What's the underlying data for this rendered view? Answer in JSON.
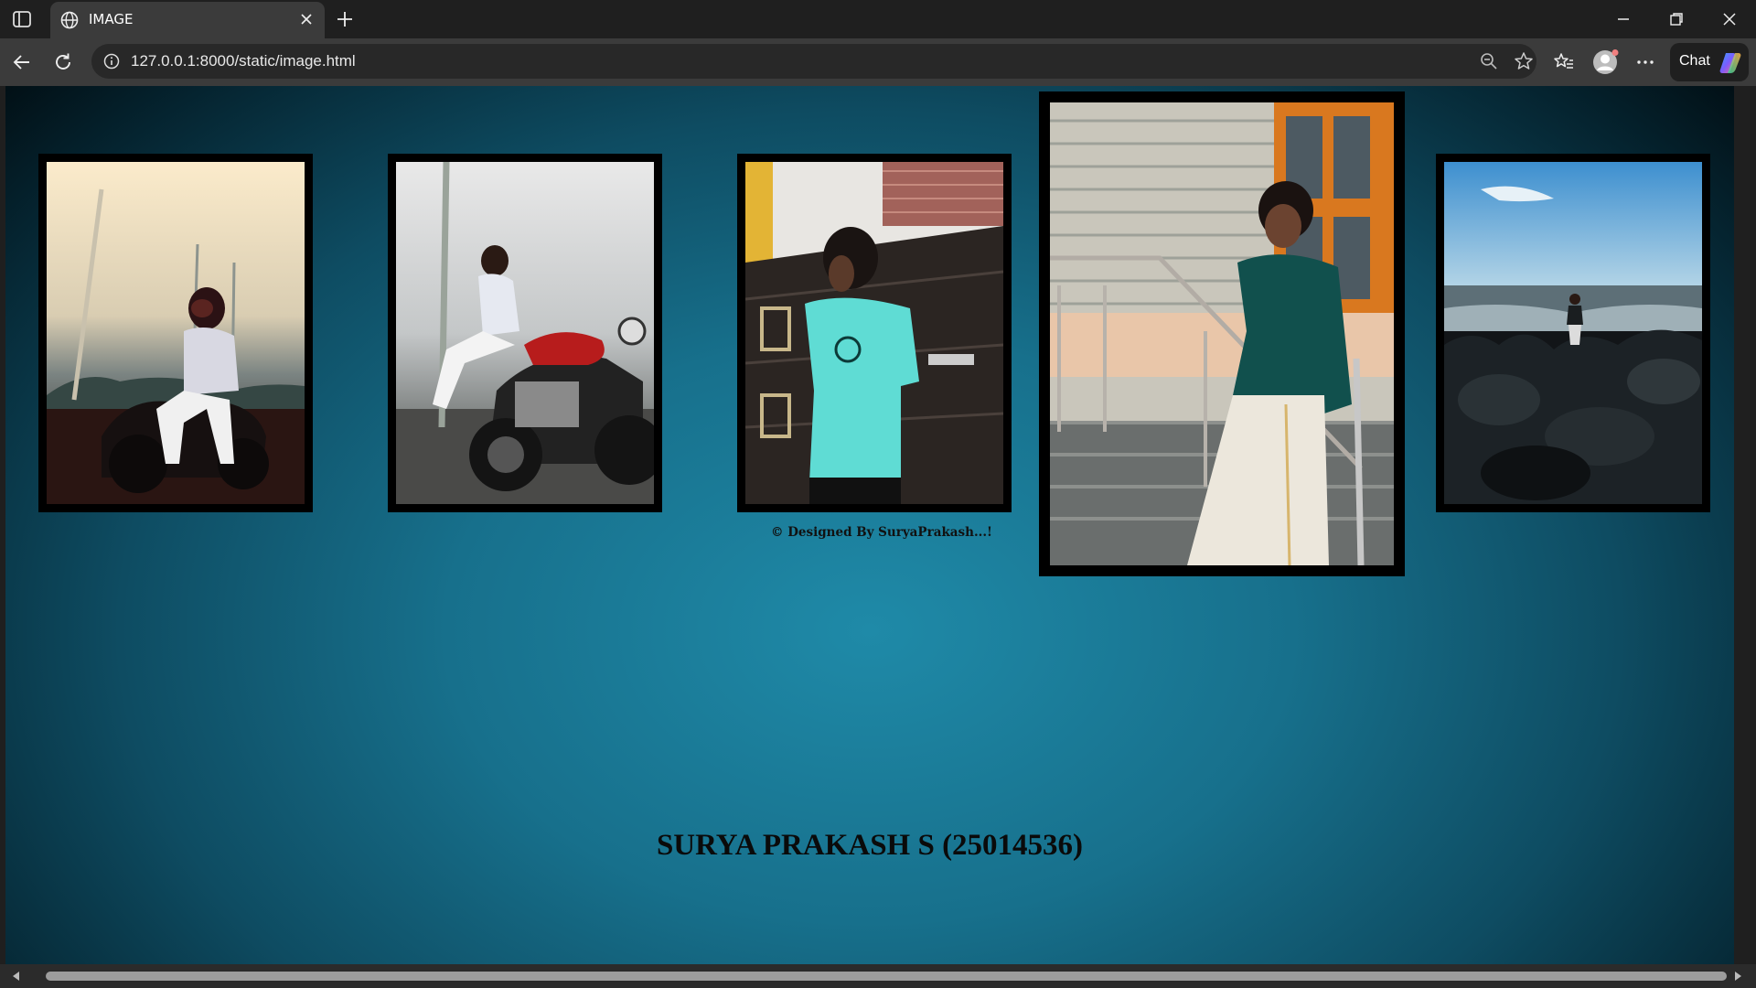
{
  "browser": {
    "tab_title": "IMAGE",
    "url": "127.0.0.1:8000/static/image.html",
    "chat_label": "Chat"
  },
  "page": {
    "photos": [
      {
        "name": "photo-man-helmet-bike",
        "icon": "photo-of-person-on-motorcycle-wearing-helmet"
      },
      {
        "name": "photo-man-red-motorcycle",
        "icon": "photo-of-person-sitting-on-red-motorcycle"
      },
      {
        "name": "photo-man-teal-tshirt",
        "icon": "photo-of-person-in-teal-tshirt-by-door"
      },
      {
        "name": "photo-man-dhoti-stairs",
        "icon": "photo-of-person-in-green-shirt-on-stairs"
      },
      {
        "name": "photo-man-on-rocks-sea",
        "icon": "photo-of-person-on-rocks-by-sea"
      }
    ],
    "credit": "© Designed By SuryaPrakash...!",
    "heading": "SURYA PRAKASH S (25014536)"
  },
  "colors": {
    "background_center": "#1f8aa8",
    "background_edge": "#010a0e",
    "frame": "#000000"
  }
}
